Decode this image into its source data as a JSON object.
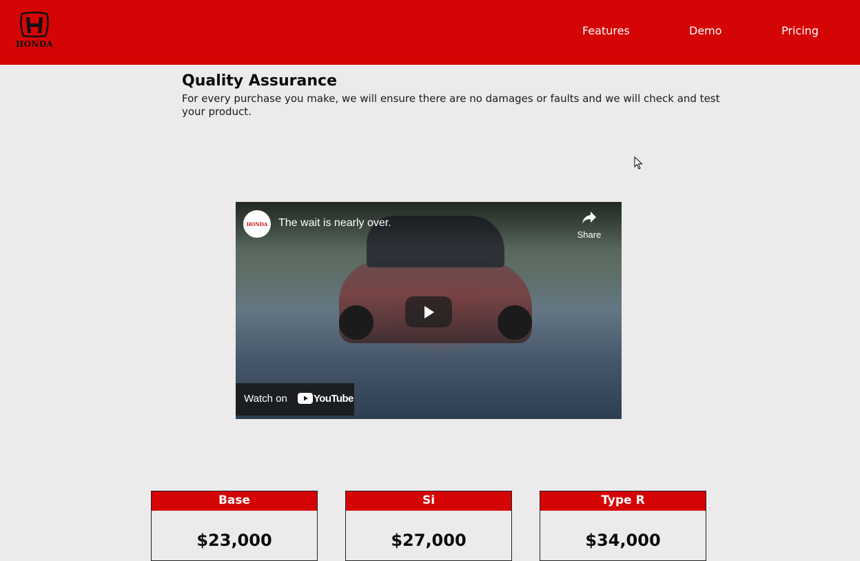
{
  "brand": {
    "logo_text": "HONDA",
    "primary_color": "#d50505"
  },
  "nav": {
    "features": "Features",
    "demo": "Demo",
    "pricing": "Pricing"
  },
  "quality": {
    "title": "Quality Assurance",
    "text": "For every purchase you make, we will ensure there are no damages or faults and we will check and test your product."
  },
  "video": {
    "channel_badge": "HONDA",
    "title": "The wait is nearly over.",
    "share_label": "Share",
    "watch_on_label": "Watch on",
    "youtube_word": "YouTube"
  },
  "pricing": {
    "cards": [
      {
        "name": "Base",
        "price": "$23,000"
      },
      {
        "name": "Si",
        "price": "$27,000"
      },
      {
        "name": "Type R",
        "price": "$34,000"
      }
    ]
  }
}
